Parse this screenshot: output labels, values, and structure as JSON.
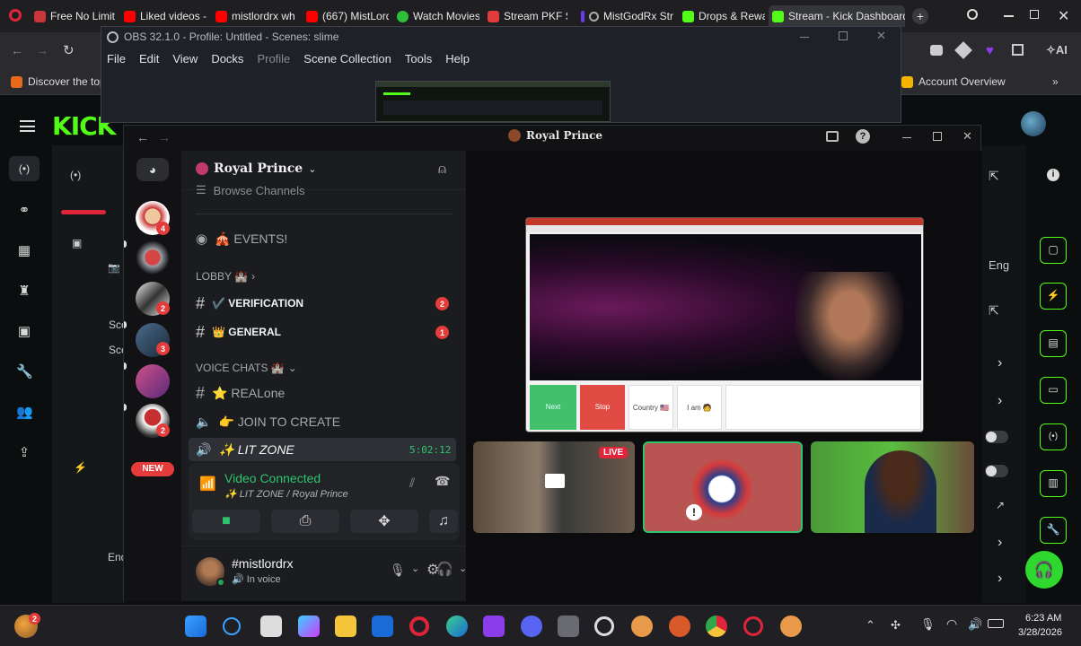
{
  "browser": {
    "tabs": [
      {
        "label": "Free No Limit",
        "color": "#c8363c"
      },
      {
        "label": "Liked videos -",
        "color": "#ff0000"
      },
      {
        "label": "mistlordrx wh",
        "color": "#ff0000"
      },
      {
        "label": "(667) MistLord",
        "color": "#ff0000"
      },
      {
        "label": "Watch Movies",
        "color": "#2fbf3a"
      },
      {
        "label": "Stream PKF Sk",
        "color": "#e23b3b"
      },
      {
        "label": "MistGodRx Str",
        "color": "#6a3de8"
      },
      {
        "label": "Drops & Rewa",
        "color": "#53fc18"
      },
      {
        "label": "Stream - Kick Dashboard",
        "color": "#53fc18"
      }
    ],
    "bookmark_left": "Discover the top",
    "bookmark_right": "Account Overview",
    "ai_label": "AI"
  },
  "obs": {
    "title": "OBS 32.1.0 - Profile: Untitled - Scenes: slime",
    "menu": [
      "File",
      "Edit",
      "View",
      "Docks",
      "Profile",
      "Scene Collection",
      "Tools",
      "Help"
    ]
  },
  "kick": {
    "logo": "KICK",
    "eng_label": "Eng",
    "scene_labels": [
      "Sce",
      "Sce"
    ],
    "end_label": "End"
  },
  "discord": {
    "window_title": "Royal Prince",
    "server_name": "Royal Prince",
    "browse_channels": "Browse Channels",
    "events": "🎪 EVENTS!",
    "lobby_category": "LOBBY 🏰",
    "verification": "✔️ VERIFICATION",
    "verification_badge": "2",
    "general": "👑 GENERAL",
    "general_badge": "1",
    "voice_category": "VOICE CHATS 🏰",
    "realone": "⭐ REALone",
    "join_to_create": "👉 JOIN TO CREATE",
    "lit_zone": "✨ LIT ZONE",
    "lit_zone_timer": "5:02:12",
    "server_badges": [
      "4",
      "2",
      "3",
      "2"
    ],
    "new_badge": "NEW",
    "video_connected": "Video Connected",
    "voice_location": "✨ LIT ZONE / Royal Prince",
    "username": "#mistlordrx",
    "user_status": "In voice",
    "live_label": "LIVE"
  },
  "omegle": {
    "next_label": "Next",
    "stop_label": "Stop",
    "country_label": "Country 🇺🇸",
    "iam_label": "I am 🧑"
  },
  "taskbar": {
    "time": "6:23 AM",
    "date": "3/28/2026",
    "notification_badge": "2"
  },
  "colors": {
    "kick_green": "#53fc18",
    "discord_blurple": "#5865f2",
    "mention_red": "#e53b3b",
    "live_red": "#e0243a"
  }
}
